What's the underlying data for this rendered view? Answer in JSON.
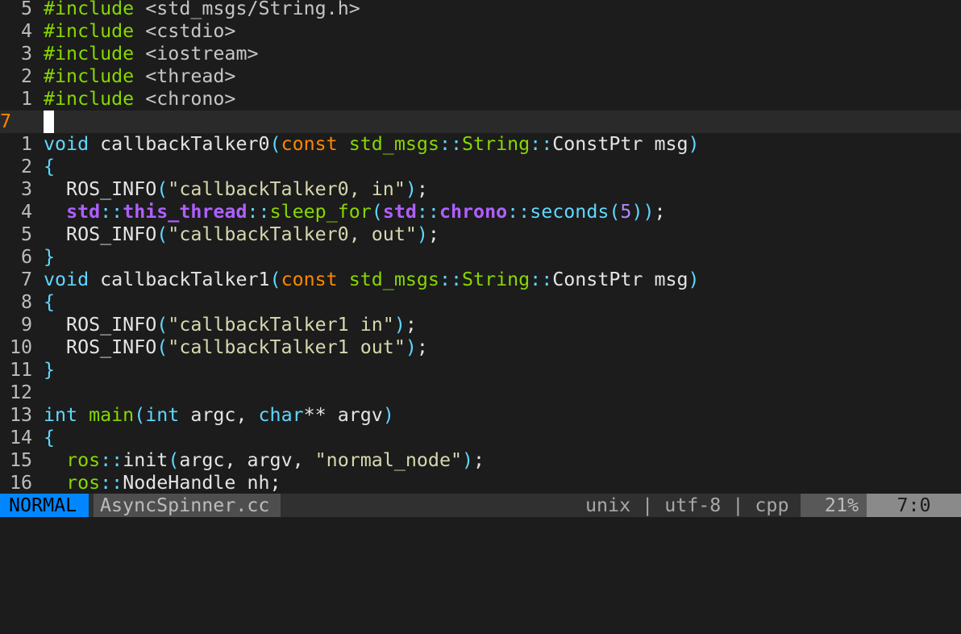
{
  "editor": {
    "lines": [
      {
        "num": "5",
        "tokens": [
          [
            "pre",
            "#include"
          ],
          [
            "id",
            " "
          ],
          [
            "inc",
            "<std_msgs/String.h>"
          ]
        ]
      },
      {
        "num": "4",
        "tokens": [
          [
            "pre",
            "#include"
          ],
          [
            "id",
            " "
          ],
          [
            "inc",
            "<cstdio>"
          ]
        ]
      },
      {
        "num": "3",
        "tokens": [
          [
            "pre",
            "#include"
          ],
          [
            "id",
            " "
          ],
          [
            "inc",
            "<iostream>"
          ]
        ]
      },
      {
        "num": "2",
        "tokens": [
          [
            "pre",
            "#include"
          ],
          [
            "id",
            " "
          ],
          [
            "inc",
            "<thread>"
          ]
        ]
      },
      {
        "num": "1",
        "tokens": [
          [
            "pre",
            "#include"
          ],
          [
            "id",
            " "
          ],
          [
            "inc",
            "<chrono>"
          ]
        ]
      },
      {
        "num": "7",
        "current": true,
        "tokens": []
      },
      {
        "num": "1",
        "tokens": [
          [
            "kw",
            "void"
          ],
          [
            "id",
            " callbackTalker0"
          ],
          [
            "br",
            "("
          ],
          [
            "kw2",
            "const"
          ],
          [
            "id",
            " "
          ],
          [
            "type",
            "std_msgs"
          ],
          [
            "op",
            "::"
          ],
          [
            "type",
            "String"
          ],
          [
            "op",
            "::"
          ],
          [
            "id",
            "ConstPtr msg"
          ],
          [
            "br",
            ")"
          ]
        ]
      },
      {
        "num": "2",
        "tokens": [
          [
            "br",
            "{"
          ]
        ]
      },
      {
        "num": "3",
        "tokens": [
          [
            "id",
            "  ROS_INFO"
          ],
          [
            "br",
            "("
          ],
          [
            "str",
            "\"callbackTalker0, in\""
          ],
          [
            "br",
            ")"
          ],
          [
            "id",
            ";"
          ]
        ]
      },
      {
        "num": "4",
        "tokens": [
          [
            "id",
            "  "
          ],
          [
            "ns",
            "std"
          ],
          [
            "op",
            "::"
          ],
          [
            "ns",
            "this_thread"
          ],
          [
            "op",
            "::"
          ],
          [
            "fn",
            "sleep_for"
          ],
          [
            "br",
            "("
          ],
          [
            "ns",
            "std"
          ],
          [
            "op",
            "::"
          ],
          [
            "ns",
            "chrono"
          ],
          [
            "op",
            "::"
          ],
          [
            "kw",
            "seconds"
          ],
          [
            "br",
            "("
          ],
          [
            "num",
            "5"
          ],
          [
            "br",
            "))"
          ],
          [
            "id",
            ";"
          ]
        ]
      },
      {
        "num": "5",
        "tokens": [
          [
            "id",
            "  ROS_INFO"
          ],
          [
            "br",
            "("
          ],
          [
            "str",
            "\"callbackTalker0, out\""
          ],
          [
            "br",
            ")"
          ],
          [
            "id",
            ";"
          ]
        ]
      },
      {
        "num": "6",
        "tokens": [
          [
            "br",
            "}"
          ]
        ]
      },
      {
        "num": "7",
        "tokens": [
          [
            "kw",
            "void"
          ],
          [
            "id",
            " callbackTalker1"
          ],
          [
            "br",
            "("
          ],
          [
            "kw2",
            "const"
          ],
          [
            "id",
            " "
          ],
          [
            "type",
            "std_msgs"
          ],
          [
            "op",
            "::"
          ],
          [
            "type",
            "String"
          ],
          [
            "op",
            "::"
          ],
          [
            "id",
            "ConstPtr msg"
          ],
          [
            "br",
            ")"
          ]
        ]
      },
      {
        "num": "8",
        "tokens": [
          [
            "br",
            "{"
          ]
        ]
      },
      {
        "num": "9",
        "tokens": [
          [
            "id",
            "  ROS_INFO"
          ],
          [
            "br",
            "("
          ],
          [
            "str",
            "\"callbackTalker1 in\""
          ],
          [
            "br",
            ")"
          ],
          [
            "id",
            ";"
          ]
        ]
      },
      {
        "num": "10",
        "tokens": [
          [
            "id",
            "  ROS_INFO"
          ],
          [
            "br",
            "("
          ],
          [
            "str",
            "\"callbackTalker1 out\""
          ],
          [
            "br",
            ")"
          ],
          [
            "id",
            ";"
          ]
        ]
      },
      {
        "num": "11",
        "tokens": [
          [
            "br",
            "}"
          ]
        ]
      },
      {
        "num": "12",
        "tokens": []
      },
      {
        "num": "13",
        "tokens": [
          [
            "kw",
            "int"
          ],
          [
            "id",
            " "
          ],
          [
            "fn",
            "main"
          ],
          [
            "br",
            "("
          ],
          [
            "kw",
            "int"
          ],
          [
            "id",
            " argc, "
          ],
          [
            "kw",
            "char"
          ],
          [
            "id",
            "** argv"
          ],
          [
            "br",
            ")"
          ]
        ]
      },
      {
        "num": "14",
        "tokens": [
          [
            "br",
            "{"
          ]
        ]
      },
      {
        "num": "15",
        "tokens": [
          [
            "id",
            "  "
          ],
          [
            "fn",
            "ros"
          ],
          [
            "op",
            "::"
          ],
          [
            "id",
            "init"
          ],
          [
            "br",
            "("
          ],
          [
            "id",
            "argc, argv, "
          ],
          [
            "str",
            "\"normal_node\""
          ],
          [
            "br",
            ")"
          ],
          [
            "id",
            ";"
          ]
        ]
      },
      {
        "num": "16",
        "tokens": [
          [
            "id",
            "  "
          ],
          [
            "fn",
            "ros"
          ],
          [
            "op",
            "::"
          ],
          [
            "id",
            "NodeHandle nh;"
          ]
        ]
      }
    ]
  },
  "statusline": {
    "mode": "NORMAL",
    "filename": "AsyncSpinner.cc",
    "fileformat": "unix",
    "sep1": " | ",
    "encoding": "utf-8",
    "sep2": " | ",
    "filetype": "cpp",
    "percent": "21%",
    "position": "7:0"
  },
  "colors": {
    "background": "#1c1c1c",
    "cursorline": "#2a2a2a",
    "mode_bg": "#0087ff",
    "preproc": "#87d700",
    "keyword": "#5fd7ff",
    "string": "#d7d7af",
    "namespace": "#af5fff"
  }
}
